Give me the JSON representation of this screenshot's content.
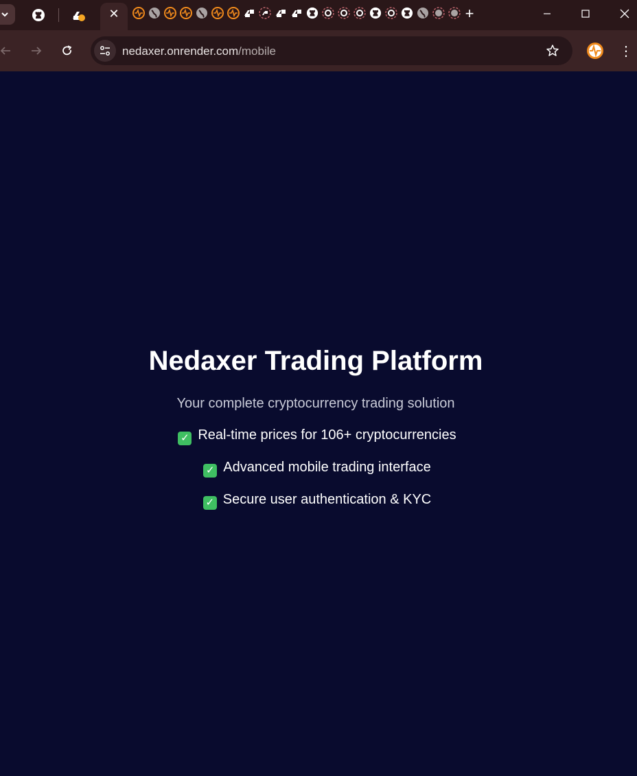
{
  "browser": {
    "tabs": {
      "active_close": "✕",
      "new_tab": "+"
    },
    "window": {
      "minimize": "—",
      "maximize": "☐",
      "close": "✕"
    },
    "address_bar": {
      "domain": "nedaxer.onrender.com",
      "path": "/mobile"
    },
    "menu": "⋮"
  },
  "page": {
    "title": "Nedaxer Trading Platform",
    "subtitle": "Your complete cryptocurrency trading solution",
    "features": [
      "Real-time prices for 106+ cryptocurrencies",
      "Advanced mobile trading interface",
      "Secure user authentication & KYC"
    ],
    "check_glyph": "✓"
  },
  "colors": {
    "background": "#090b2e",
    "check": "#3fbf62",
    "accent_orange": "#f08a1c"
  }
}
